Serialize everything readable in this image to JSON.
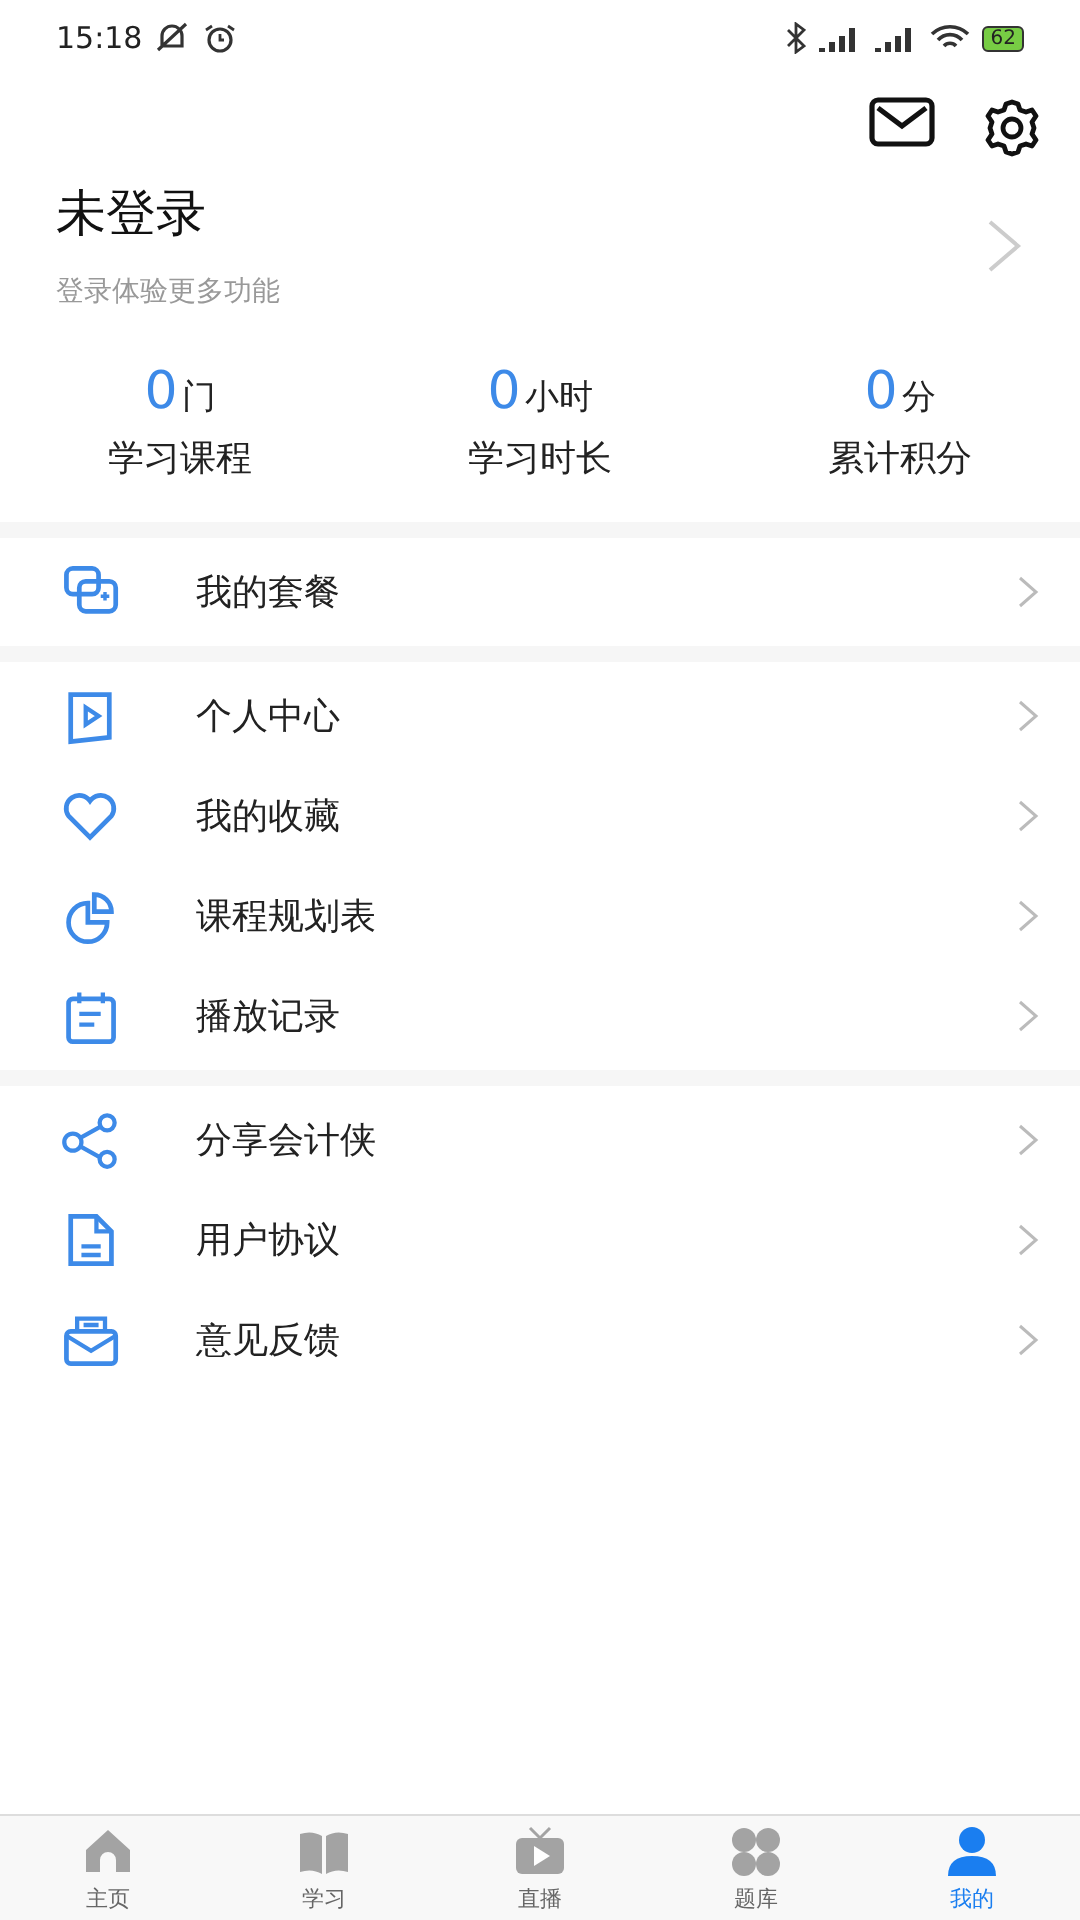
{
  "status_bar": {
    "time": "15:18",
    "battery": "62"
  },
  "profile": {
    "name": "未登录",
    "subtitle": "登录体验更多功能"
  },
  "stats": [
    {
      "value": "0",
      "unit": "门",
      "label": "学习课程"
    },
    {
      "value": "0",
      "unit": "小时",
      "label": "学习时长"
    },
    {
      "value": "0",
      "unit": "分",
      "label": "累计积分"
    }
  ],
  "menu_groups": [
    [
      {
        "kind": "package",
        "label": "我的套餐"
      }
    ],
    [
      {
        "kind": "video",
        "label": "个人中心"
      },
      {
        "kind": "heart",
        "label": "我的收藏"
      },
      {
        "kind": "chart",
        "label": "课程规划表"
      },
      {
        "kind": "calendar",
        "label": "播放记录"
      }
    ],
    [
      {
        "kind": "share",
        "label": "分享会计侠"
      },
      {
        "kind": "document",
        "label": "用户协议"
      },
      {
        "kind": "mail",
        "label": "意见反馈"
      }
    ]
  ],
  "tab_bar": [
    {
      "kind": "home",
      "label": "主页",
      "selected": false
    },
    {
      "kind": "book",
      "label": "学习",
      "selected": false
    },
    {
      "kind": "tv",
      "label": "直播",
      "selected": false
    },
    {
      "kind": "clover",
      "label": "题库",
      "selected": false
    },
    {
      "kind": "person",
      "label": "我的",
      "selected": true
    }
  ]
}
